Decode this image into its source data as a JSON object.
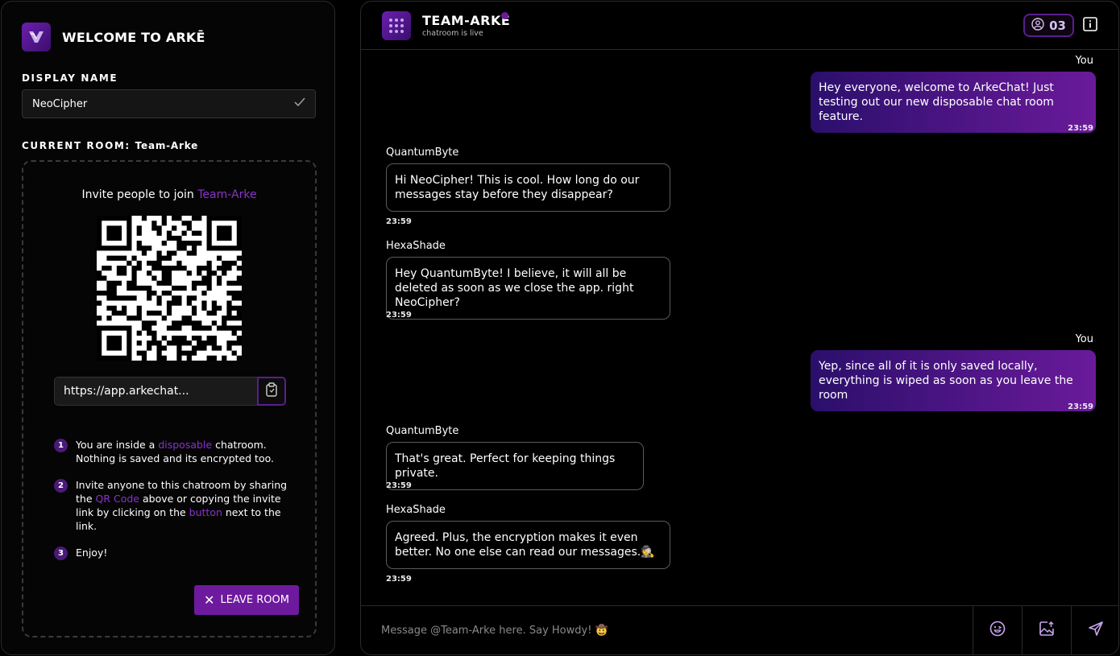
{
  "sidebar": {
    "brand_title": "WELCOME TO ARKĒ",
    "display_name_label": "DISPLAY NAME",
    "display_name_value": "NeoCipher",
    "current_room_label": "CURRENT ROOM:",
    "current_room_value": "Team-Arke",
    "invite_prefix": "Invite people to join",
    "invite_room": "Team-Arke",
    "invite_link": "https://app.arkechat...",
    "steps": [
      {
        "num": "1",
        "a": "You are inside a ",
        "hl1": "disposable",
        "b": " chatroom. Nothing is saved and its encrypted too.",
        "hl2": "",
        "c": ""
      },
      {
        "num": "2",
        "a": "Invite anyone to this chatroom by sharing the ",
        "hl1": "QR Code",
        "b": " above or copying the invite link by clicking on the ",
        "hl2": "button",
        "c": " next to the link."
      },
      {
        "num": "3",
        "a": "Enjoy!",
        "hl1": "",
        "b": "",
        "hl2": "",
        "c": ""
      }
    ],
    "leave_label": "LEAVE ROOM"
  },
  "chat": {
    "room_title": "TEAM-ARKĒ",
    "room_status": "chatroom is live",
    "user_count": "03",
    "composer_placeholder": "Message @Team-Arke here. Say Howdy! 🤠",
    "messages": [
      {
        "author": "You",
        "text": "Hey everyone, welcome to ArkeChat! Just testing out our new disposable chat room feature.",
        "time": "23:59",
        "outgoing": true
      },
      {
        "author": "QuantumByte",
        "text": "Hi NeoCipher! This is cool. How long do our messages stay before they disappear?",
        "time": "23:59",
        "outgoing": false
      },
      {
        "author": "HexaShade",
        "text": "Hey QuantumByte! I believe, it will all be deleted as soon as we close the app. right NeoCipher?",
        "time": "23:59",
        "outgoing": false
      },
      {
        "author": "You",
        "text": "Yep, since all of it is only saved locally, everything is wiped as soon as you leave the room",
        "time": "23:59",
        "outgoing": true
      },
      {
        "author": "QuantumByte",
        "text": "That's great. Perfect for keeping things private.",
        "time": "23:59",
        "outgoing": false
      },
      {
        "author": "HexaShade",
        "text": "Agreed. Plus, the encryption makes it even better. No one else can read our messages.🕵️",
        "time": "23:59",
        "outgoing": false
      }
    ]
  },
  "icons": {
    "logo": "arke-logo-icon",
    "check": "check-icon",
    "copy": "clipboard-copy-icon",
    "leave": "close-icon",
    "users": "user-icon",
    "info": "info-icon",
    "emoji": "emoji-icon",
    "image": "image-upload-icon",
    "send": "send-icon"
  },
  "colors": {
    "accent": "#6e1a9e",
    "accent_text": "#8a33c9",
    "bubble_out_start": "#2b0f6b",
    "bubble_out_end": "#6a1a9a"
  }
}
